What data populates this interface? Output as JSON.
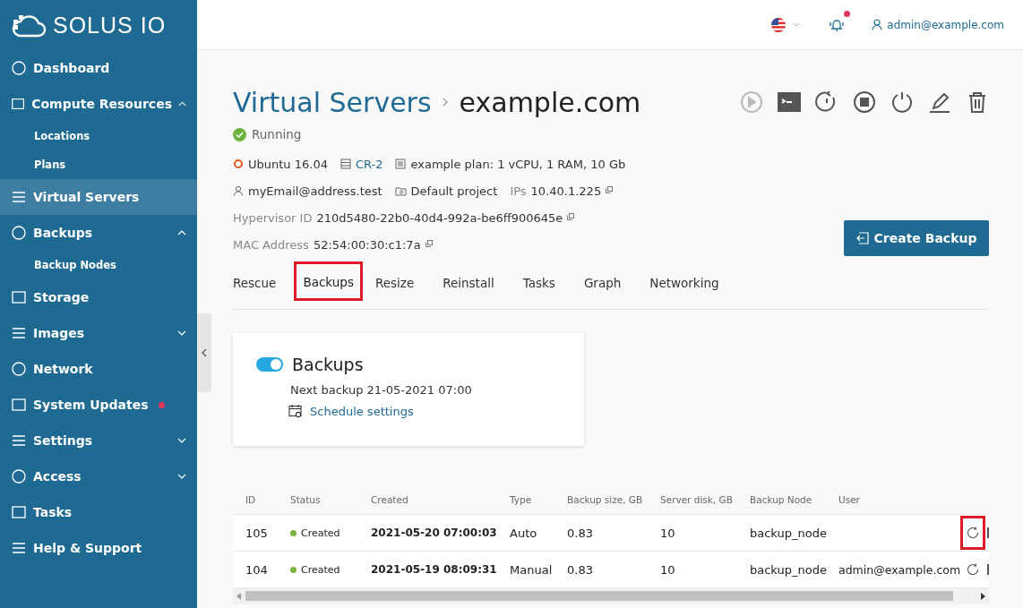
{
  "sidebar": {
    "logo": "SOLUS IO",
    "items": [
      {
        "label": "Dashboard",
        "selected": false
      },
      {
        "label": "Compute Resources",
        "selected": false,
        "expanded": true,
        "children": [
          {
            "label": "Locations"
          },
          {
            "label": "Plans"
          }
        ]
      },
      {
        "label": "Virtual Servers",
        "selected": true
      },
      {
        "label": "Backups",
        "selected": false,
        "expanded": true,
        "children": [
          {
            "label": "Backup Nodes"
          }
        ]
      },
      {
        "label": "Storage",
        "selected": false
      },
      {
        "label": "Images",
        "selected": false,
        "expanded": false
      },
      {
        "label": "Network",
        "selected": false
      },
      {
        "label": "System Updates",
        "selected": false,
        "alert": true
      },
      {
        "label": "Settings",
        "selected": false,
        "expanded": false
      },
      {
        "label": "Access",
        "selected": false,
        "expanded": false
      },
      {
        "label": "Tasks",
        "selected": false
      },
      {
        "label": "Help & Support",
        "selected": false
      }
    ]
  },
  "header": {
    "user": "admin@example.com",
    "notification": true
  },
  "page": {
    "breadcrumb": "Virtual Servers",
    "title": "example.com",
    "status": "Running",
    "actions": [
      {
        "kind": "start",
        "disabled": true
      },
      {
        "kind": "console",
        "disabled": false
      },
      {
        "kind": "restart",
        "disabled": false
      },
      {
        "kind": "stop",
        "disabled": false
      },
      {
        "kind": "power",
        "disabled": false
      },
      {
        "kind": "edit",
        "disabled": false
      },
      {
        "kind": "delete",
        "disabled": false
      }
    ],
    "os": "Ubuntu 16.04",
    "compute_resource": "CR-2",
    "plan": "example plan: 1 vCPU, 1 RAM, 10 Gb",
    "owner": "myEmail@address.test",
    "project": "Default project",
    "ips_label": "IPs",
    "ips": "10.40.1.225",
    "hypervisor_label": "Hypervisor ID",
    "hypervisor_id": "210d5480-22b0-40d4-992a-be6ff900645e",
    "mac_label": "MAC Address",
    "mac": "52:54:00:30:c1:7a",
    "create_button": "Create Backup"
  },
  "tabs": [
    {
      "label": "Rescue",
      "selected": false,
      "highlighted": false
    },
    {
      "label": "Backups",
      "selected": true,
      "highlighted": true
    },
    {
      "label": "Resize",
      "selected": false,
      "highlighted": false
    },
    {
      "label": "Reinstall",
      "selected": false,
      "highlighted": false
    },
    {
      "label": "Tasks",
      "selected": false,
      "highlighted": false
    },
    {
      "label": "Graph",
      "selected": false,
      "highlighted": false
    },
    {
      "label": "Networking",
      "selected": false,
      "highlighted": false
    }
  ],
  "backups_card": {
    "enabled": true,
    "title": "Backups",
    "next_backup": "Next backup 21-05-2021 07:00",
    "schedule_link": "Schedule settings"
  },
  "table": {
    "columns": [
      "ID",
      "Status",
      "Created",
      "Type",
      "Backup size, GB",
      "Server disk, GB",
      "Backup Node",
      "User"
    ],
    "rows": [
      {
        "id": "105",
        "status": "Created",
        "color": "#7cb342",
        "created": "2021-05-20 07:00:03",
        "type": "Auto",
        "size": "0.83",
        "disk": "10",
        "node": "backup_node",
        "user": "",
        "highlighted": true
      },
      {
        "id": "104",
        "status": "Created",
        "color": "#7cb342",
        "created": "2021-05-19 08:09:31",
        "type": "Manual",
        "size": "0.83",
        "disk": "10",
        "node": "backup_node",
        "user": "admin@example.com",
        "highlighted": false
      }
    ]
  }
}
